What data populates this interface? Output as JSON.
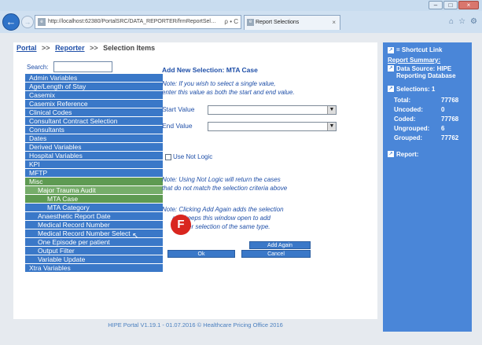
{
  "browser": {
    "address": "http://localhost:62380/PortalSRC/DATA_REPORTER/frmReportSel…",
    "address_host": "localhost",
    "address_tools": "ρ • C",
    "tab_label": "Report Selections",
    "tab_close": "×",
    "back_glyph": "←",
    "fwd_glyph": "→",
    "win_min": "–",
    "win_max": "□",
    "win_close": "×",
    "icon_home": "⌂",
    "icon_star": "☆",
    "icon_gear": "⚙"
  },
  "breadcrumb": {
    "portal": "Portal",
    "reporter": "Reporter",
    "current": "Selection Items",
    "sep": ">>"
  },
  "search": {
    "label": "Search:",
    "value": ""
  },
  "menu": [
    {
      "label": "Admin Variables",
      "level": "top"
    },
    {
      "label": "Age/Length of Stay",
      "level": "top"
    },
    {
      "label": "Casemix",
      "level": "top"
    },
    {
      "label": "Casemix Reference",
      "level": "top"
    },
    {
      "label": "Clinical Codes",
      "level": "top"
    },
    {
      "label": "Consultant Contract Selection",
      "level": "top"
    },
    {
      "label": "Consultants",
      "level": "top"
    },
    {
      "label": "Dates",
      "level": "top"
    },
    {
      "label": "Derived Variables",
      "level": "top"
    },
    {
      "label": "Hospital Variables",
      "level": "top"
    },
    {
      "label": "KPI",
      "level": "top"
    },
    {
      "label": "MFTP",
      "level": "top"
    },
    {
      "label": "Misc",
      "level": "l1"
    },
    {
      "label": "Major Trauma Audit",
      "level": "l2"
    },
    {
      "label": "MTA Case",
      "level": "l3sel"
    },
    {
      "label": "MTA Category",
      "level": "l3"
    },
    {
      "label": "Anaesthetic Report Date",
      "level": "sub"
    },
    {
      "label": "Medical Record Number",
      "level": "sub"
    },
    {
      "label": "Medical Record Number Select",
      "level": "sub"
    },
    {
      "label": "One Episode per patient",
      "level": "sub"
    },
    {
      "label": "Output Filter",
      "level": "sub"
    },
    {
      "label": "Variable Update",
      "level": "sub"
    },
    {
      "label": "Xtra Variables",
      "level": "top"
    }
  ],
  "form": {
    "title": "Add New Selection: MTA Case",
    "note1_line1": "Note: If you wish to select a single value,",
    "note1_line2": "enter this value as both the start and end value.",
    "start_label": "Start Value",
    "end_label": "End Value",
    "start_value": "",
    "end_value": "",
    "not_logic_label": "Use Not Logic",
    "note2_line1": "Note: Using Not Logic will return the cases",
    "note2_line2": "that do not match the selection criteria above",
    "note3_line1": "Note: Clicking Add Again adds the selection",
    "note3_line2": "and keeps this window open to add",
    "note3_line3": "another selection of the same type.",
    "add_again": "Add Again",
    "ok": "Ok",
    "cancel": "Cancel",
    "badge": "F"
  },
  "summary": {
    "shortcut": "= Shortcut Link",
    "heading": "Report Summary:",
    "data_source_label": "Data Source: HIPE",
    "data_source_sub": "Reporting Database",
    "selections": "Selections: 1",
    "stats": [
      {
        "k": "Total:",
        "v": "77768"
      },
      {
        "k": "Uncoded:",
        "v": "0"
      },
      {
        "k": "Coded:",
        "v": "77768"
      },
      {
        "k": "Ungrouped:",
        "v": "6"
      },
      {
        "k": "Grouped:",
        "v": "77762"
      }
    ],
    "report": "Report:"
  },
  "footer": "HIPE Portal V1.19.1 - 01.07.2016 © Healthcare Pricing Office 2016"
}
